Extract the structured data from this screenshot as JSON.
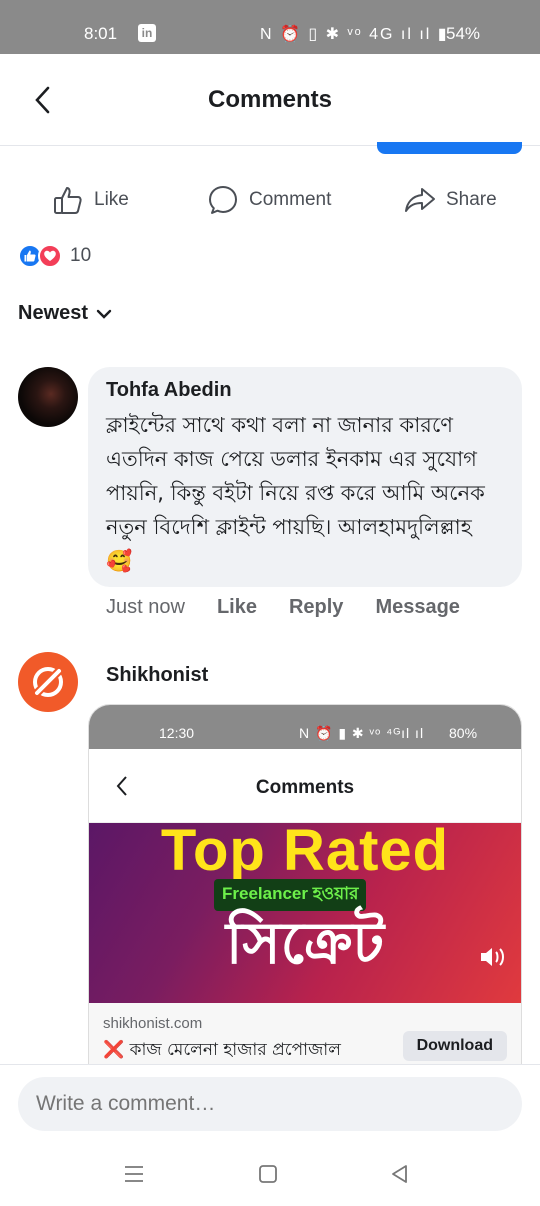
{
  "status_bar": {
    "time": "8:01",
    "linkedin": "in",
    "icons": "N ⏰ ▯ ✱ ᵛᵒ 4G ıl ıl ▮",
    "battery": "54%"
  },
  "header": {
    "title": "Comments"
  },
  "actions": {
    "like": "Like",
    "comment": "Comment",
    "share": "Share"
  },
  "reactions": {
    "count": "10"
  },
  "sort": {
    "label": "Newest"
  },
  "comments": [
    {
      "author": "Tohfa Abedin",
      "text": "ক্লাইন্টের  সাথে  কথা বলা না জানার কারণে এতদিন কাজ পেয়ে ডলার ইনকাম এর সুযোগ পায়নি, কিন্তু   বইটা নিয়ে রপ্ত করে আমি অনেক নতুন বিদেশি ক্লাইন্ট পায়ছি। আলহামদুলিল্লাহ 🥰",
      "time": "Just now",
      "like": "Like",
      "reply": "Reply",
      "message": "Message"
    },
    {
      "author": "Shikhonist"
    }
  ],
  "attachment": {
    "status": {
      "time": "12:30",
      "icons": "N ⏰ ▮ ✱ ᵛᵒ ⁴ᴳıl ıl",
      "battery": "80%"
    },
    "title": "Comments",
    "promo": {
      "top": "Top Rated",
      "sub": "Freelancer হওয়ার",
      "big": "সিক্রেট"
    },
    "link": {
      "domain": "shikhonist.com",
      "x": "❌",
      "title": "কাজ মেলেনা হাজার প্রপোজাল",
      "button": "Download"
    }
  },
  "composer": {
    "placeholder": "Write a comment…"
  },
  "colors": {
    "accent": "#1877f2",
    "love": "#f33e58",
    "brand_orange": "#f15a29"
  }
}
